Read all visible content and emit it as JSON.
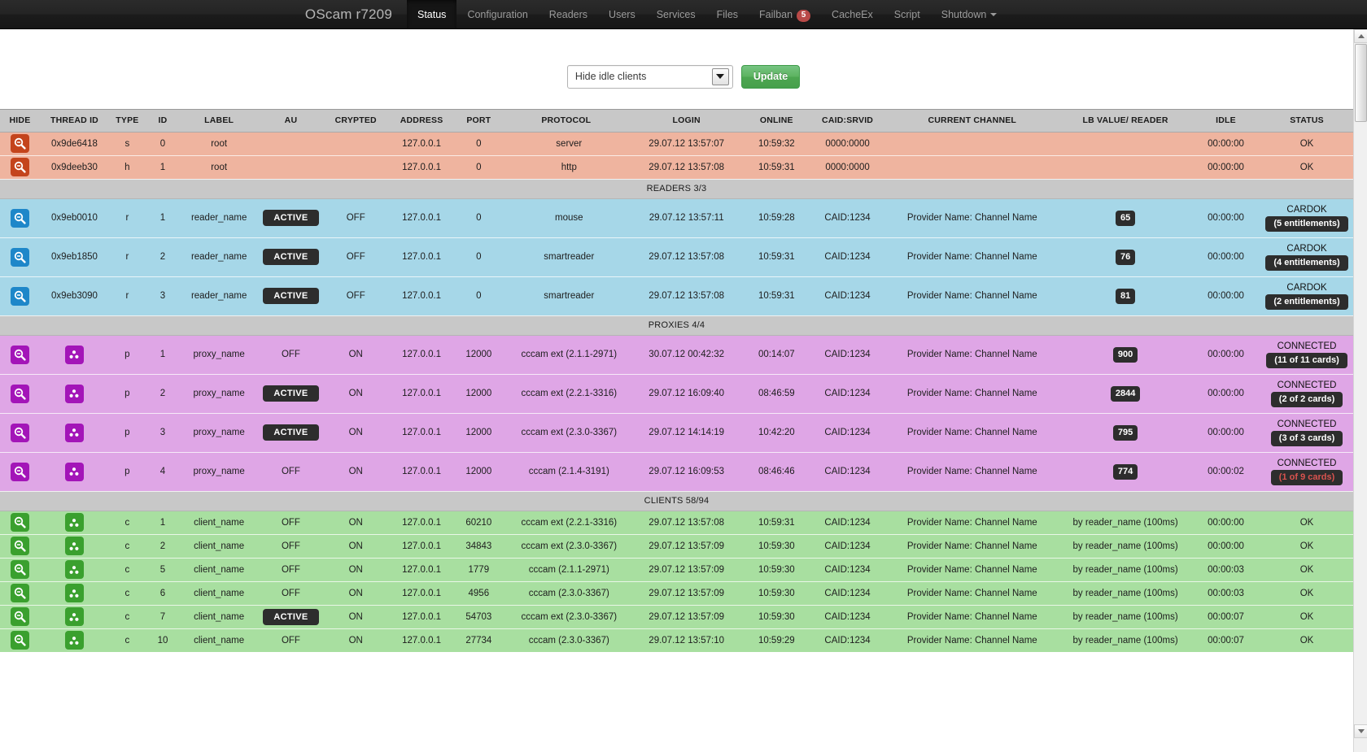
{
  "navbar": {
    "brand": "OScam r7209",
    "items": [
      {
        "label": "Status",
        "active": true
      },
      {
        "label": "Configuration",
        "active": false
      },
      {
        "label": "Readers",
        "active": false
      },
      {
        "label": "Users",
        "active": false
      },
      {
        "label": "Services",
        "active": false
      },
      {
        "label": "Files",
        "active": false
      },
      {
        "label": "Failban",
        "active": false,
        "badge": "5"
      },
      {
        "label": "CacheEx",
        "active": false
      },
      {
        "label": "Script",
        "active": false
      },
      {
        "label": "Shutdown",
        "active": false,
        "caret": true
      }
    ]
  },
  "controls": {
    "filter_selected": "Hide idle clients",
    "update_label": "Update"
  },
  "table": {
    "columns": [
      "HIDE",
      "THREAD ID",
      "TYPE",
      "ID",
      "LABEL",
      "AU",
      "CRYPTED",
      "ADDRESS",
      "PORT",
      "PROTOCOL",
      "LOGIN",
      "ONLINE",
      "CAID:SRVID",
      "CURRENT CHANNEL",
      "LB VALUE/ READER",
      "IDLE",
      "STATUS"
    ],
    "sections": [
      {
        "kind": "server",
        "header": null,
        "rows": [
          {
            "icon": "zoom-out-icon",
            "thread_id": "0x9de6418",
            "type": "s",
            "id": "0",
            "label": "root",
            "au": "",
            "crypted": "",
            "address": "127.0.0.1",
            "port": "0",
            "protocol": "server",
            "login": "29.07.12 13:57:07",
            "online": "10:59:32",
            "caid": "0000:0000",
            "channel": "",
            "lb": "",
            "idle": "00:00:00",
            "status": "OK"
          },
          {
            "icon": "zoom-out-icon",
            "thread_id": "0x9deeb30",
            "type": "h",
            "id": "1",
            "label": "root",
            "au": "",
            "crypted": "",
            "address": "127.0.0.1",
            "port": "0",
            "protocol": "http",
            "login": "29.07.12 13:57:08",
            "online": "10:59:31",
            "caid": "0000:0000",
            "channel": "",
            "lb": "",
            "idle": "00:00:00",
            "status": "OK"
          }
        ]
      },
      {
        "kind": "reader",
        "header": "READERS 3/3",
        "rows": [
          {
            "icon": "zoom-in-icon",
            "thread_id": "0x9eb0010",
            "type": "r",
            "id": "1",
            "label": "reader_name",
            "au": "ACTIVE",
            "crypted": "OFF",
            "address": "127.0.0.1",
            "port": "0",
            "protocol": "mouse",
            "login": "29.07.12 13:57:11",
            "online": "10:59:28",
            "caid": "CAID:1234",
            "channel": "Provider Name: Channel Name",
            "lb": "65",
            "idle": "00:00:00",
            "status": "CARDOK",
            "status_sub": "(5 entitlements)"
          },
          {
            "icon": "zoom-in-icon",
            "thread_id": "0x9eb1850",
            "type": "r",
            "id": "2",
            "label": "reader_name",
            "au": "ACTIVE",
            "crypted": "OFF",
            "address": "127.0.0.1",
            "port": "0",
            "protocol": "smartreader",
            "login": "29.07.12 13:57:08",
            "online": "10:59:31",
            "caid": "CAID:1234",
            "channel": "Provider Name: Channel Name",
            "lb": "76",
            "idle": "00:00:00",
            "status": "CARDOK",
            "status_sub": "(4 entitlements)"
          },
          {
            "icon": "zoom-in-icon",
            "thread_id": "0x9eb3090",
            "type": "r",
            "id": "3",
            "label": "reader_name",
            "au": "ACTIVE",
            "crypted": "OFF",
            "address": "127.0.0.1",
            "port": "0",
            "protocol": "smartreader",
            "login": "29.07.12 13:57:08",
            "online": "10:59:31",
            "caid": "CAID:1234",
            "channel": "Provider Name: Channel Name",
            "lb": "81",
            "idle": "00:00:00",
            "status": "CARDOK",
            "status_sub": "(2 entitlements)"
          }
        ]
      },
      {
        "kind": "proxy",
        "header": "PROXIES 4/4",
        "rows": [
          {
            "icon": "zoom-in-icon",
            "tid_icon": "radiation-icon",
            "thread_id": "",
            "type": "p",
            "id": "1",
            "label": "proxy_name",
            "au": "OFF",
            "crypted": "ON",
            "address": "127.0.0.1",
            "port": "12000",
            "protocol": "cccam ext (2.1.1-2971)",
            "login": "30.07.12 00:42:32",
            "online": "00:14:07",
            "caid": "CAID:1234",
            "channel": "Provider Name: Channel Name",
            "lb": "900",
            "idle": "00:00:00",
            "status": "CONNECTED",
            "status_sub": "(11 of 11 cards)"
          },
          {
            "icon": "zoom-in-icon",
            "tid_icon": "radiation-icon",
            "thread_id": "",
            "type": "p",
            "id": "2",
            "label": "proxy_name",
            "au": "ACTIVE",
            "crypted": "ON",
            "address": "127.0.0.1",
            "port": "12000",
            "protocol": "cccam ext (2.2.1-3316)",
            "login": "29.07.12 16:09:40",
            "online": "08:46:59",
            "caid": "CAID:1234",
            "channel": "Provider Name: Channel Name",
            "lb": "2844",
            "idle": "00:00:00",
            "status": "CONNECTED",
            "status_sub": "(2 of 2 cards)"
          },
          {
            "icon": "zoom-in-icon",
            "tid_icon": "radiation-icon",
            "thread_id": "",
            "type": "p",
            "id": "3",
            "label": "proxy_name",
            "au": "ACTIVE",
            "crypted": "ON",
            "address": "127.0.0.1",
            "port": "12000",
            "protocol": "cccam ext (2.3.0-3367)",
            "login": "29.07.12 14:14:19",
            "online": "10:42:20",
            "caid": "CAID:1234",
            "channel": "Provider Name: Channel Name",
            "lb": "795",
            "idle": "00:00:00",
            "status": "CONNECTED",
            "status_sub": "(3 of 3 cards)"
          },
          {
            "icon": "zoom-in-icon",
            "tid_icon": "radiation-icon",
            "thread_id": "",
            "type": "p",
            "id": "4",
            "label": "proxy_name",
            "au": "OFF",
            "crypted": "ON",
            "address": "127.0.0.1",
            "port": "12000",
            "protocol": "cccam (2.1.4-3191)",
            "login": "29.07.12 16:09:53",
            "online": "08:46:46",
            "caid": "CAID:1234",
            "channel": "Provider Name: Channel Name",
            "lb": "774",
            "idle": "00:00:02",
            "status": "CONNECTED",
            "status_sub": "(1 of 9 cards)",
            "status_warn": true
          }
        ]
      },
      {
        "kind": "client",
        "header": "CLIENTS 58/94",
        "rows": [
          {
            "icon": "zoom-in-icon",
            "tid_icon": "radiation-icon",
            "thread_id": "",
            "type": "c",
            "id": "1",
            "label": "client_name",
            "au": "OFF",
            "crypted": "ON",
            "address": "127.0.0.1",
            "port": "60210",
            "protocol": "cccam ext (2.2.1-3316)",
            "login": "29.07.12 13:57:08",
            "online": "10:59:31",
            "caid": "CAID:1234",
            "channel": "Provider Name: Channel Name",
            "lb": "by reader_name (100ms)",
            "idle": "00:00:00",
            "status": "OK"
          },
          {
            "icon": "zoom-in-icon",
            "tid_icon": "radiation-icon",
            "thread_id": "",
            "type": "c",
            "id": "2",
            "label": "client_name",
            "au": "OFF",
            "crypted": "ON",
            "address": "127.0.0.1",
            "port": "34843",
            "protocol": "cccam ext (2.3.0-3367)",
            "login": "29.07.12 13:57:09",
            "online": "10:59:30",
            "caid": "CAID:1234",
            "channel": "Provider Name: Channel Name",
            "lb": "by reader_name (100ms)",
            "idle": "00:00:00",
            "status": "OK"
          },
          {
            "icon": "zoom-in-icon",
            "tid_icon": "radiation-icon",
            "thread_id": "",
            "type": "c",
            "id": "5",
            "label": "client_name",
            "au": "OFF",
            "crypted": "ON",
            "address": "127.0.0.1",
            "port": "1779",
            "protocol": "cccam (2.1.1-2971)",
            "login": "29.07.12 13:57:09",
            "online": "10:59:30",
            "caid": "CAID:1234",
            "channel": "Provider Name: Channel Name",
            "lb": "by reader_name (100ms)",
            "idle": "00:00:03",
            "status": "OK"
          },
          {
            "icon": "zoom-in-icon",
            "tid_icon": "radiation-icon",
            "thread_id": "",
            "type": "c",
            "id": "6",
            "label": "client_name",
            "au": "OFF",
            "crypted": "ON",
            "address": "127.0.0.1",
            "port": "4956",
            "protocol": "cccam (2.3.0-3367)",
            "login": "29.07.12 13:57:09",
            "online": "10:59:30",
            "caid": "CAID:1234",
            "channel": "Provider Name: Channel Name",
            "lb": "by reader_name (100ms)",
            "idle": "00:00:03",
            "status": "OK"
          },
          {
            "icon": "zoom-in-icon",
            "tid_icon": "radiation-icon",
            "thread_id": "",
            "type": "c",
            "id": "7",
            "label": "client_name",
            "au": "ACTIVE",
            "crypted": "ON",
            "address": "127.0.0.1",
            "port": "54703",
            "protocol": "cccam ext (2.3.0-3367)",
            "login": "29.07.12 13:57:09",
            "online": "10:59:30",
            "caid": "CAID:1234",
            "channel": "Provider Name: Channel Name",
            "lb": "by reader_name (100ms)",
            "idle": "00:00:07",
            "status": "OK"
          },
          {
            "icon": "zoom-in-icon",
            "tid_icon": "radiation-icon",
            "thread_id": "",
            "type": "c",
            "id": "10",
            "label": "client_name",
            "au": "OFF",
            "crypted": "ON",
            "address": "127.0.0.1",
            "port": "27734",
            "protocol": "cccam (2.3.0-3367)",
            "login": "29.07.12 13:57:10",
            "online": "10:59:29",
            "caid": "CAID:1234",
            "channel": "Provider Name: Channel Name",
            "lb": "by reader_name (100ms)",
            "idle": "00:00:07",
            "status": "OK"
          }
        ]
      }
    ]
  },
  "colors": {
    "server_row": "#efb49f",
    "reader_row": "#a6d7e8",
    "proxy_row": "#dfa6e6",
    "client_row": "#a8dfa0",
    "section_row": "#c8c8c8",
    "nav_bg": "#1f1f1f",
    "badge_red": "#b94a48",
    "update_green": "#5cb35f",
    "warn_red": "#d9534f"
  }
}
